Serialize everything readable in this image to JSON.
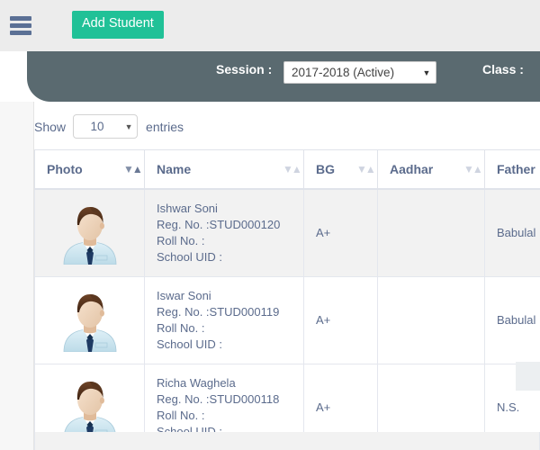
{
  "topbar": {
    "menu_icon": "hamburger-menu-icon"
  },
  "actionbar": {
    "add_student_label": "Add Student",
    "session_label": "Session :",
    "session_value": "2017-2018 (Active)",
    "class_label": "Class :",
    "background_color": "#5a6a70",
    "accent_color": "#20c197"
  },
  "table_controls": {
    "show_label": "Show",
    "entries_value": "10",
    "entries_label": "entries"
  },
  "table": {
    "columns": [
      {
        "label": "Photo",
        "sortable": true,
        "sort_state": "descending"
      },
      {
        "label": "Name",
        "sortable": true,
        "sort_state": "none"
      },
      {
        "label": "BG",
        "sortable": true,
        "sort_state": "none"
      },
      {
        "label": "Aadhar",
        "sortable": true,
        "sort_state": "none"
      },
      {
        "label": "Father",
        "sortable": true,
        "sort_state": "none"
      }
    ],
    "rows": [
      {
        "photo": "default-male-avatar",
        "name": "Ishwar Soni",
        "reg_no": "Reg. No. :STUD000120",
        "roll_no": "Roll No. :",
        "school_uid": "School UID :",
        "bg": "A+",
        "aadhar": "",
        "father": "Babulal",
        "striped": true
      },
      {
        "photo": "default-male-avatar",
        "name": "Iswar Soni",
        "reg_no": "Reg. No. :STUD000119",
        "roll_no": "Roll No. :",
        "school_uid": "School UID :",
        "bg": "A+",
        "aadhar": "",
        "father": "Babulal",
        "striped": false
      },
      {
        "photo": "default-male-avatar",
        "name": "Richa Waghela",
        "reg_no": "Reg. No. :STUD000118",
        "roll_no": "Roll No. :",
        "school_uid": "School UID :",
        "bg": "A+",
        "aadhar": "",
        "father": "N.S.",
        "striped": false
      }
    ]
  }
}
